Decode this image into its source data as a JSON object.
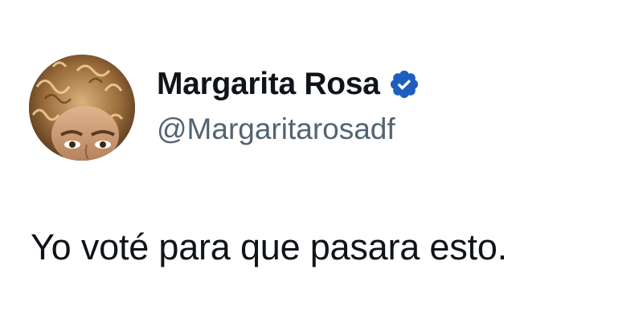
{
  "author": {
    "display_name": "Margarita Rosa",
    "handle": "@Margaritarosadf",
    "verified_icon": "verified-badge-icon",
    "verified_color": "#1d5fbf"
  },
  "tweet": {
    "text": "Yo voté para que pasara esto."
  },
  "colors": {
    "name": "#0f1419",
    "handle": "#536471",
    "text": "#0f1419",
    "background": "#ffffff"
  }
}
